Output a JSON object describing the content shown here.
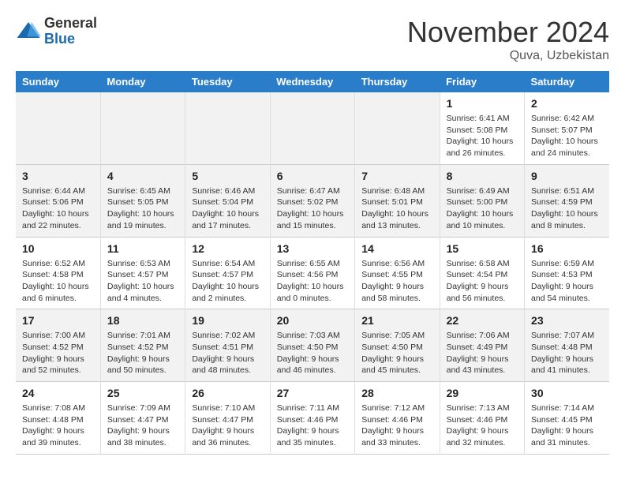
{
  "header": {
    "logo_general": "General",
    "logo_blue": "Blue",
    "month_title": "November 2024",
    "location": "Quva, Uzbekistan"
  },
  "columns": [
    "Sunday",
    "Monday",
    "Tuesday",
    "Wednesday",
    "Thursday",
    "Friday",
    "Saturday"
  ],
  "weeks": [
    [
      {
        "day": "",
        "info": ""
      },
      {
        "day": "",
        "info": ""
      },
      {
        "day": "",
        "info": ""
      },
      {
        "day": "",
        "info": ""
      },
      {
        "day": "",
        "info": ""
      },
      {
        "day": "1",
        "info": "Sunrise: 6:41 AM\nSunset: 5:08 PM\nDaylight: 10 hours and 26 minutes."
      },
      {
        "day": "2",
        "info": "Sunrise: 6:42 AM\nSunset: 5:07 PM\nDaylight: 10 hours and 24 minutes."
      }
    ],
    [
      {
        "day": "3",
        "info": "Sunrise: 6:44 AM\nSunset: 5:06 PM\nDaylight: 10 hours and 22 minutes."
      },
      {
        "day": "4",
        "info": "Sunrise: 6:45 AM\nSunset: 5:05 PM\nDaylight: 10 hours and 19 minutes."
      },
      {
        "day": "5",
        "info": "Sunrise: 6:46 AM\nSunset: 5:04 PM\nDaylight: 10 hours and 17 minutes."
      },
      {
        "day": "6",
        "info": "Sunrise: 6:47 AM\nSunset: 5:02 PM\nDaylight: 10 hours and 15 minutes."
      },
      {
        "day": "7",
        "info": "Sunrise: 6:48 AM\nSunset: 5:01 PM\nDaylight: 10 hours and 13 minutes."
      },
      {
        "day": "8",
        "info": "Sunrise: 6:49 AM\nSunset: 5:00 PM\nDaylight: 10 hours and 10 minutes."
      },
      {
        "day": "9",
        "info": "Sunrise: 6:51 AM\nSunset: 4:59 PM\nDaylight: 10 hours and 8 minutes."
      }
    ],
    [
      {
        "day": "10",
        "info": "Sunrise: 6:52 AM\nSunset: 4:58 PM\nDaylight: 10 hours and 6 minutes."
      },
      {
        "day": "11",
        "info": "Sunrise: 6:53 AM\nSunset: 4:57 PM\nDaylight: 10 hours and 4 minutes."
      },
      {
        "day": "12",
        "info": "Sunrise: 6:54 AM\nSunset: 4:57 PM\nDaylight: 10 hours and 2 minutes."
      },
      {
        "day": "13",
        "info": "Sunrise: 6:55 AM\nSunset: 4:56 PM\nDaylight: 10 hours and 0 minutes."
      },
      {
        "day": "14",
        "info": "Sunrise: 6:56 AM\nSunset: 4:55 PM\nDaylight: 9 hours and 58 minutes."
      },
      {
        "day": "15",
        "info": "Sunrise: 6:58 AM\nSunset: 4:54 PM\nDaylight: 9 hours and 56 minutes."
      },
      {
        "day": "16",
        "info": "Sunrise: 6:59 AM\nSunset: 4:53 PM\nDaylight: 9 hours and 54 minutes."
      }
    ],
    [
      {
        "day": "17",
        "info": "Sunrise: 7:00 AM\nSunset: 4:52 PM\nDaylight: 9 hours and 52 minutes."
      },
      {
        "day": "18",
        "info": "Sunrise: 7:01 AM\nSunset: 4:52 PM\nDaylight: 9 hours and 50 minutes."
      },
      {
        "day": "19",
        "info": "Sunrise: 7:02 AM\nSunset: 4:51 PM\nDaylight: 9 hours and 48 minutes."
      },
      {
        "day": "20",
        "info": "Sunrise: 7:03 AM\nSunset: 4:50 PM\nDaylight: 9 hours and 46 minutes."
      },
      {
        "day": "21",
        "info": "Sunrise: 7:05 AM\nSunset: 4:50 PM\nDaylight: 9 hours and 45 minutes."
      },
      {
        "day": "22",
        "info": "Sunrise: 7:06 AM\nSunset: 4:49 PM\nDaylight: 9 hours and 43 minutes."
      },
      {
        "day": "23",
        "info": "Sunrise: 7:07 AM\nSunset: 4:48 PM\nDaylight: 9 hours and 41 minutes."
      }
    ],
    [
      {
        "day": "24",
        "info": "Sunrise: 7:08 AM\nSunset: 4:48 PM\nDaylight: 9 hours and 39 minutes."
      },
      {
        "day": "25",
        "info": "Sunrise: 7:09 AM\nSunset: 4:47 PM\nDaylight: 9 hours and 38 minutes."
      },
      {
        "day": "26",
        "info": "Sunrise: 7:10 AM\nSunset: 4:47 PM\nDaylight: 9 hours and 36 minutes."
      },
      {
        "day": "27",
        "info": "Sunrise: 7:11 AM\nSunset: 4:46 PM\nDaylight: 9 hours and 35 minutes."
      },
      {
        "day": "28",
        "info": "Sunrise: 7:12 AM\nSunset: 4:46 PM\nDaylight: 9 hours and 33 minutes."
      },
      {
        "day": "29",
        "info": "Sunrise: 7:13 AM\nSunset: 4:46 PM\nDaylight: 9 hours and 32 minutes."
      },
      {
        "day": "30",
        "info": "Sunrise: 7:14 AM\nSunset: 4:45 PM\nDaylight: 9 hours and 31 minutes."
      }
    ]
  ]
}
